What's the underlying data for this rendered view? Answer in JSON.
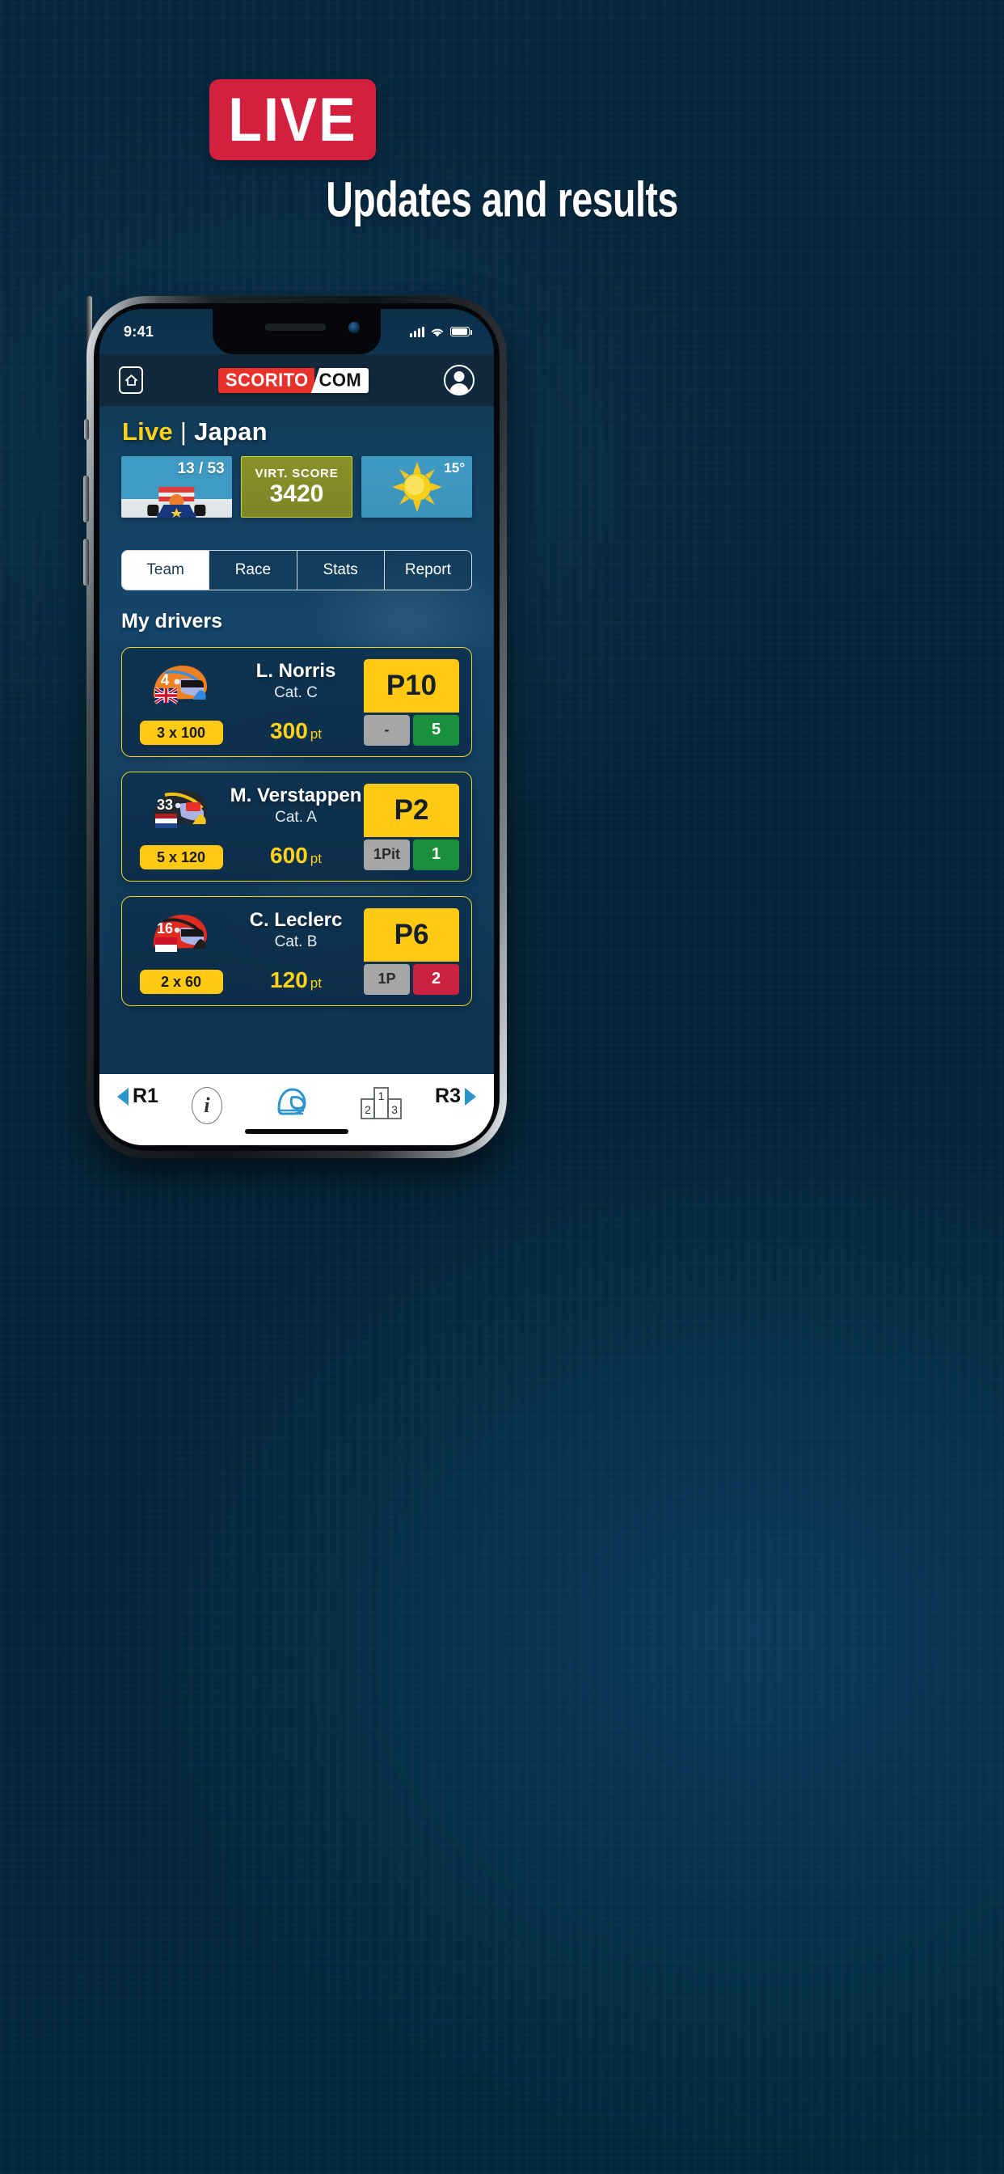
{
  "hero": {
    "badge_label": "LIVE",
    "badge_color": "#d4203f",
    "subtitle": "Updates and results"
  },
  "phone": {
    "status_bar": {
      "time": "9:41",
      "signal_icon": "cellular-bars-icon",
      "wifi_icon": "wifi-icon",
      "battery_icon": "battery-icon"
    },
    "app_header": {
      "home_icon": "home-icon",
      "logo_red": "SCORITO",
      "logo_white": "COM",
      "account_icon": "account-avatar-icon"
    },
    "page_title": {
      "live": "Live",
      "separator": "|",
      "event": "Japan",
      "live_color": "#ffd21a"
    },
    "info_cards": {
      "lap": {
        "value": "13 / 53",
        "icon": "f1-car-icon"
      },
      "score": {
        "label": "VIRT. SCORE",
        "value": "3420",
        "bg_color": "#8a9129",
        "border_color": "#cbd43a"
      },
      "weather": {
        "temp": "15°",
        "icon": "sun-icon"
      }
    },
    "tabs": [
      {
        "label": "Team",
        "active": true
      },
      {
        "label": "Race",
        "active": false
      },
      {
        "label": "Stats",
        "active": false
      },
      {
        "label": "Report",
        "active": false
      }
    ],
    "section_title": "My drivers",
    "drivers": [
      {
        "number": "4",
        "flag": "gb-flag-icon",
        "helmet_color": "#f08020",
        "multiplier": "3 x 100",
        "name": "L. Norris",
        "category": "Cat. C",
        "points": "300",
        "points_unit": "pt",
        "position": "P10",
        "pit": "-",
        "delta": "5",
        "delta_color": "#1a8f3c"
      },
      {
        "number": "33",
        "flag": "nl-flag-icon",
        "helmet_color": "#23272e",
        "multiplier": "5 x 120",
        "name": "M. Verstappen",
        "category": "Cat. A",
        "points": "600",
        "points_unit": "pt",
        "position": "P2",
        "pit": "1Pit",
        "delta": "1",
        "delta_color": "#1a8f3c"
      },
      {
        "number": "16",
        "flag": "mc-flag-icon",
        "helmet_color": "#e02b20",
        "multiplier": "2 x 60",
        "name": "C. Leclerc",
        "category": "Cat. B",
        "points": "120",
        "points_unit": "pt",
        "position": "P6",
        "pit": "1P",
        "delta": "2",
        "delta_color": "#c9213f"
      }
    ],
    "bottom_nav": {
      "prev_label": "R1",
      "next_label": "R3",
      "prev_icon": "chevron-left-icon",
      "next_icon": "chevron-right-icon",
      "info_icon": "info-icon",
      "helmet_icon": "helmet-icon",
      "podium_icon": "podium-icon",
      "podium_labels": {
        "first": "1",
        "second": "2",
        "third": "3"
      },
      "active_tab": "helmet"
    }
  }
}
